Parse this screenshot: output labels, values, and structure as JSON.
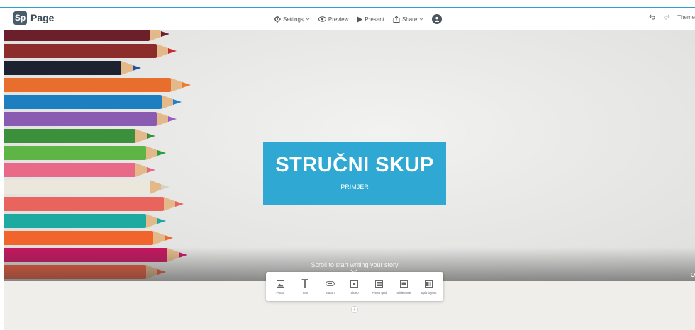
{
  "app": {
    "logo_badge": "Sp",
    "logo_text": "Page"
  },
  "header": {
    "settings_label": "Settings",
    "preview_label": "Preview",
    "present_label": "Present",
    "share_label": "Share",
    "theme_label": "Theme"
  },
  "hero": {
    "title": "STRUČNI SKUP",
    "subtitle": "PRIMJER",
    "scroll_hint": "Scroll to start writing your story"
  },
  "toolbar": {
    "items": [
      {
        "label": "Photo",
        "icon": "photo-icon"
      },
      {
        "label": "Text",
        "icon": "text-icon"
      },
      {
        "label": "Button",
        "icon": "link-icon"
      },
      {
        "label": "Video",
        "icon": "video-icon"
      },
      {
        "label": "Photo grid",
        "icon": "photo-grid-icon"
      },
      {
        "label": "Slideshow",
        "icon": "slideshow-icon"
      },
      {
        "label": "Split layout",
        "icon": "split-layout-icon"
      }
    ]
  },
  "colors": {
    "accent": "#2fa9d3",
    "brand_badge": "#4a5b6a",
    "pencils": [
      "#6b1f2a",
      "#8c2c2b",
      "#1e2230",
      "#e86e2e",
      "#1e7fc0",
      "#8a5cb1",
      "#3c8f3b",
      "#5fb446",
      "#e86a88",
      "#ece7dc",
      "#e9645c",
      "#1eaaa0",
      "#f1642b",
      "#c4165f",
      "#ef5a3a"
    ]
  },
  "plus_symbol": "+"
}
